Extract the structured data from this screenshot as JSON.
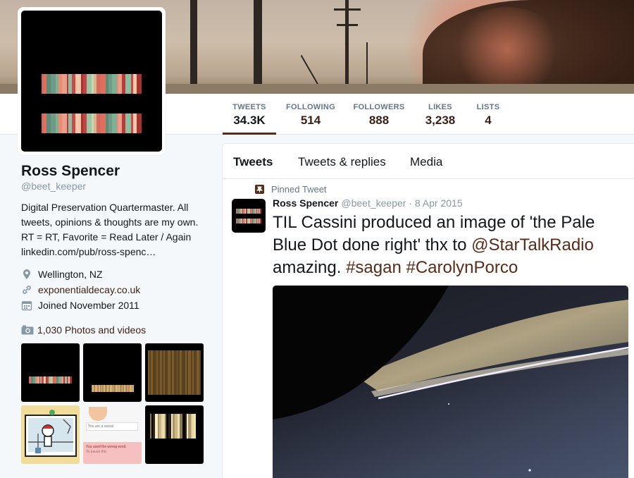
{
  "stats": [
    {
      "label": "TWEETS",
      "value": "34.3K",
      "active": true
    },
    {
      "label": "FOLLOWING",
      "value": "514"
    },
    {
      "label": "FOLLOWERS",
      "value": "888"
    },
    {
      "label": "LIKES",
      "value": "3,238"
    },
    {
      "label": "LISTS",
      "value": "4"
    }
  ],
  "profile": {
    "name": "Ross Spencer",
    "handle": "@beet_keeper",
    "bio_line1": "Digital Preservation Quartermaster. All",
    "bio_line2": "tweets, opinions & thoughts are my own.",
    "bio_line3": "RT = RT, Favorite = Read Later / Again",
    "bio_link": "linkedin.com/pub/ross-spenc…",
    "location": "Wellington, NZ",
    "website": "exponentialdecay.co.uk",
    "joined": "Joined November 2011",
    "photos_label": "1,030 Photos and videos"
  },
  "thumb_text": {
    "t5_top": "You are a rascal",
    "t5_bottom": "You used the wrong word.",
    "t5_bottom2": "To pause this"
  },
  "timeline": {
    "tabs": [
      "Tweets",
      "Tweets & replies",
      "Media"
    ],
    "pinned_label": "Pinned Tweet",
    "tweet": {
      "name": "Ross Spencer",
      "handle": "@beet_keeper",
      "separator": " · ",
      "date": "8 Apr 2015",
      "text_part1": "TIL Cassini produced an image of 'the Pale Blue Dot done right' thx to ",
      "mention": "@StarTalkRadio",
      "text_part2": " amazing. ",
      "hashtag1": "#sagan",
      "space": " ",
      "hashtag2": "#CarolynPorco"
    }
  },
  "colors": {
    "accent": "#5b2b1a",
    "link": "#3d1f15",
    "muted": "#8899a6",
    "barcode": [
      "#c94a4a",
      "#e8a08a",
      "#6e9a86",
      "#d46b5e",
      "#9cc5a4",
      "#f1c7a8",
      "#b83a3a",
      "#7fb095",
      "#e0705e",
      "#c9d6b0",
      "#a63232",
      "#8fbfa0",
      "#ec8a74",
      "#5f8b76",
      "#d9b48e",
      "#c24545"
    ]
  },
  "icons": {
    "location": "map-pin-icon",
    "website": "link-icon",
    "joined": "calendar-icon",
    "photos": "camera-icon",
    "pinned": "pin-icon"
  }
}
